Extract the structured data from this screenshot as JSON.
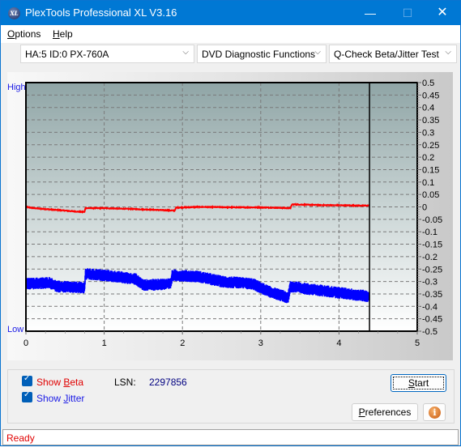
{
  "window": {
    "title": "PlexTools Professional XL V3.16",
    "app_icon_text": "XL",
    "controls": {
      "minimize": "—",
      "maximize": "☐",
      "close": "✕"
    }
  },
  "menu": {
    "items": [
      {
        "label": "Options",
        "accel": "O",
        "rest": "ptions"
      },
      {
        "label": "Help",
        "accel": "H",
        "rest": "elp"
      }
    ]
  },
  "toolbar": {
    "drive_select": "HA:5 ID:0  PX-760A",
    "function_select": "DVD Diagnostic Functions",
    "test_select": "Q-Check Beta/Jitter Test",
    "chevron": "⌵"
  },
  "chart_labels": {
    "high": "High",
    "low": "Low"
  },
  "controls": {
    "show_beta": {
      "label_prefix": "Show ",
      "accel": "B",
      "label_rest": "eta",
      "checked": true,
      "color": "#e00000"
    },
    "show_jitter": {
      "label_prefix": "Show ",
      "accel": "J",
      "label_rest": "itter",
      "checked": true,
      "color": "#1a1ae6"
    },
    "lsn_label": "LSN:",
    "lsn_value": "2297856",
    "start_button": {
      "accel": "S",
      "rest": "tart"
    },
    "preferences_button": {
      "accel": "P",
      "rest": "references"
    },
    "info_button": "i"
  },
  "status": {
    "text": "Ready"
  },
  "chart_data": {
    "type": "line",
    "title": "",
    "xlabel": "",
    "ylabel": "",
    "xlim": [
      0,
      5
    ],
    "ylim": [
      -0.5,
      0.5
    ],
    "x_ticks": [
      "0",
      "1",
      "2",
      "3",
      "4",
      "5"
    ],
    "y_ticks": [
      "0.5",
      "0.45",
      "0.4",
      "0.35",
      "0.3",
      "0.25",
      "0.2",
      "0.15",
      "0.1",
      "0.05",
      "0",
      "-0.05",
      "-0.1",
      "-0.15",
      "-0.2",
      "-0.25",
      "-0.3",
      "-0.35",
      "-0.4",
      "-0.45",
      "-0.5"
    ],
    "grid": true,
    "progress_marker_x": 4.39,
    "colors": {
      "beta": "#ff0000",
      "jitter": "#0000ff",
      "marker": "#000000"
    },
    "series": [
      {
        "name": "Beta",
        "x": [
          0.0,
          0.1,
          0.3,
          0.5,
          0.7,
          0.75,
          0.76,
          1.0,
          1.5,
          1.9,
          1.92,
          2.2,
          2.8,
          3.0,
          3.38,
          3.4,
          3.8,
          4.38
        ],
        "y": [
          0.0,
          -0.005,
          -0.01,
          -0.015,
          -0.02,
          -0.02,
          -0.005,
          -0.005,
          -0.01,
          -0.015,
          -0.003,
          0.0,
          -0.002,
          -0.002,
          -0.005,
          0.01,
          0.007,
          0.005
        ]
      },
      {
        "name": "Jitter",
        "x": [
          0.0,
          0.3,
          0.4,
          0.7,
          0.75,
          0.76,
          1.0,
          1.4,
          1.5,
          1.85,
          1.87,
          2.2,
          2.5,
          2.9,
          3.1,
          3.35,
          3.38,
          3.6,
          4.0,
          4.38
        ],
        "y": [
          -0.31,
          -0.305,
          -0.32,
          -0.325,
          -0.325,
          -0.27,
          -0.275,
          -0.29,
          -0.315,
          -0.31,
          -0.275,
          -0.28,
          -0.3,
          -0.31,
          -0.34,
          -0.365,
          -0.32,
          -0.33,
          -0.345,
          -0.36
        ]
      }
    ]
  }
}
